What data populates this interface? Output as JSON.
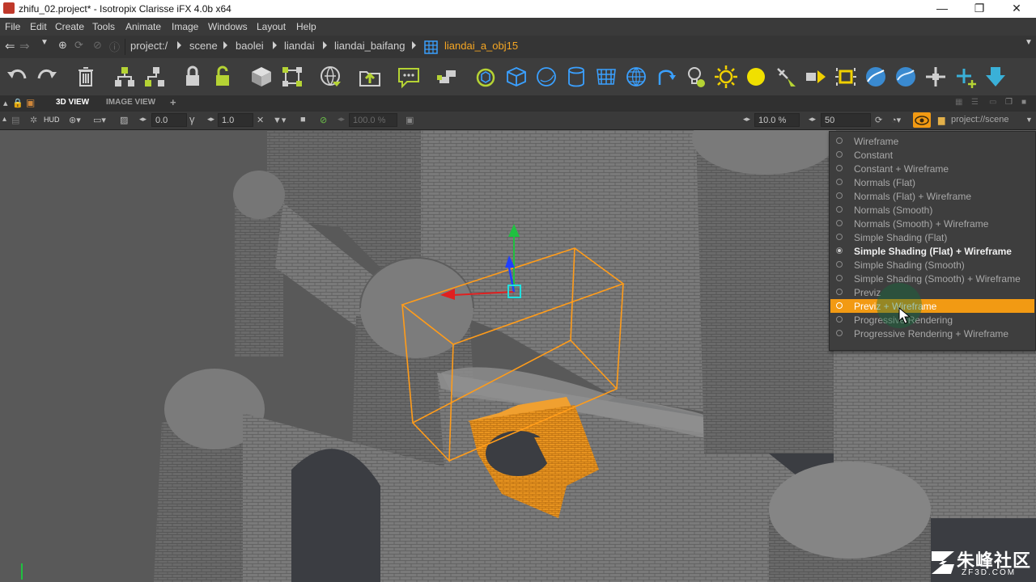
{
  "window": {
    "title": "zhifu_02.project* - Isotropix Clarisse iFX 4.0b x64",
    "controls": [
      "—",
      "❐",
      "✕"
    ]
  },
  "menu": [
    "File",
    "Edit",
    "Create",
    "Tools",
    "Animate",
    "Image",
    "Windows",
    "Layout",
    "Help"
  ],
  "path": {
    "crumbs": [
      "project:/",
      "scene",
      "baolei",
      "liandai",
      "liandai_baifang"
    ],
    "current": "liandai_a_obj15"
  },
  "toolbar": {
    "icons": [
      "undo-icon",
      "redo-icon",
      "delete-icon",
      "group-icon",
      "ungroup-icon",
      "lock-icon",
      "unlock-icon",
      "box-icon",
      "transform-icon",
      "import-icon",
      "export-icon",
      "comment-icon",
      "layers-icon",
      "refresh-icon",
      "cube-icon",
      "sphere-icon",
      "cylinder-icon",
      "grid-icon",
      "globe-icon",
      "rotate-arrow-icon",
      "light-bulb-icon",
      "sun-icon",
      "moon-icon",
      "spotlight-icon",
      "arrow-right-icon",
      "dashed-light-icon",
      "planet-icon",
      "planet2-icon",
      "scatter-icon",
      "add-scatter-icon",
      "download-icon"
    ]
  },
  "tabs": {
    "view3d": "3D VIEW",
    "image_view": "IMAGE VIEW",
    "add": "+"
  },
  "viewbar": {
    "hud": "HUD",
    "value1": "0.0",
    "value2": "1.0",
    "opacity": "100.0 %",
    "percent": "10.0 %",
    "samples": "50",
    "context": "project://scene"
  },
  "shading_menu": {
    "items": [
      {
        "label": "Wireframe",
        "state": "normal"
      },
      {
        "label": "Constant",
        "state": "normal"
      },
      {
        "label": "Constant + Wireframe",
        "state": "normal"
      },
      {
        "label": "Normals (Flat)",
        "state": "normal"
      },
      {
        "label": "Normals (Flat) + Wireframe",
        "state": "normal"
      },
      {
        "label": "Normals (Smooth)",
        "state": "normal"
      },
      {
        "label": "Normals (Smooth) + Wireframe",
        "state": "normal"
      },
      {
        "label": "Simple Shading (Flat)",
        "state": "normal"
      },
      {
        "label": "Simple Shading (Flat) + Wireframe",
        "state": "checked"
      },
      {
        "label": "Simple Shading (Smooth)",
        "state": "normal"
      },
      {
        "label": "Simple Shading (Smooth) + Wireframe",
        "state": "normal"
      },
      {
        "label": "Previz",
        "state": "normal"
      },
      {
        "label": "Previz + Wireframe",
        "state": "highlighted"
      },
      {
        "label": "Progressive Rendering",
        "state": "normal"
      },
      {
        "label": "Progressive Rendering + Wireframe",
        "state": "normal"
      }
    ]
  },
  "watermark": {
    "text": "朱峰社区",
    "sub": "ZF3D.COM"
  },
  "colors": {
    "accent": "#f29a13",
    "selection": "#ff9c1a",
    "current_path": "#f5a623"
  }
}
